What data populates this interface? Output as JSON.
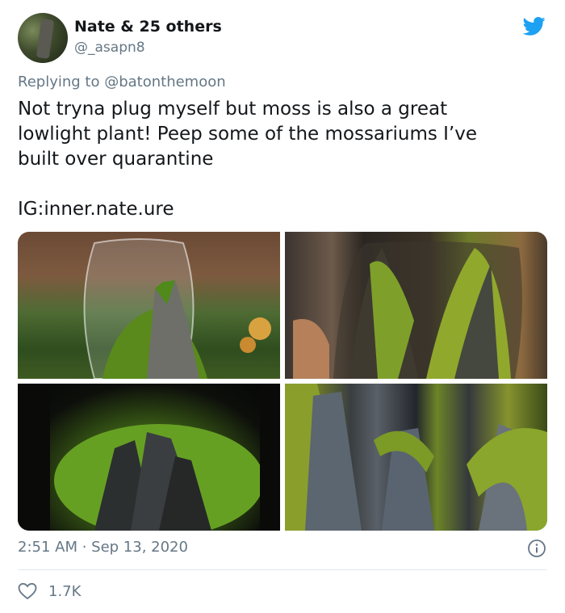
{
  "tweet": {
    "display_name": "Nate & 25 others",
    "handle": "@_asapn8",
    "replying_to": "Replying to @batonthemoon",
    "text": "Not tryna plug myself but moss is also a great\nlowlight plant! Peep some of the mossariums I’ve\nbuilt over quarantine\n\nIG:inner.nate.ure",
    "timestamp": "2:51 AM · Sep 13, 2020",
    "like_count": "1.7K"
  },
  "icons": {
    "brand": "twitter-bird-icon",
    "info": "info-icon",
    "like": "heart-icon"
  },
  "colors": {
    "twitter_blue": "#1da1f2",
    "secondary_text": "#657786",
    "primary_text": "#14171a"
  },
  "media": {
    "photo_count": 4
  }
}
